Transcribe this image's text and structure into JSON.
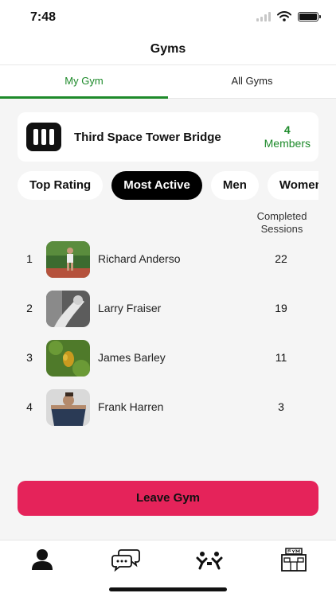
{
  "status_bar": {
    "time": "7:48"
  },
  "header": {
    "title": "Gyms"
  },
  "tabs": [
    {
      "label": "My Gym",
      "active": true
    },
    {
      "label": "All Gyms",
      "active": false
    }
  ],
  "gym": {
    "name": "Third Space Tower Bridge",
    "member_count": "4",
    "member_label": "Members"
  },
  "filters": [
    {
      "label": "Top Rating",
      "active": false
    },
    {
      "label": "Most Active",
      "active": true
    },
    {
      "label": "Men",
      "active": false
    },
    {
      "label": "Women",
      "active": false
    }
  ],
  "leaderboard": {
    "column_header": "Completed Sessions",
    "rows": [
      {
        "rank": "1",
        "name": "Richard Anderso",
        "sessions": "22"
      },
      {
        "rank": "2",
        "name": "Larry Fraiser",
        "sessions": "19"
      },
      {
        "rank": "3",
        "name": "James Barley",
        "sessions": "11"
      },
      {
        "rank": "4",
        "name": "Frank Harren",
        "sessions": "3"
      }
    ]
  },
  "actions": {
    "leave_label": "Leave Gym"
  },
  "colors": {
    "accent_green": "#1d8a2a",
    "leave_button": "#e5235a",
    "active_chip": "#000000"
  },
  "bottom_nav": [
    {
      "icon": "profile-icon",
      "active": true
    },
    {
      "icon": "chat-icon",
      "active": false
    },
    {
      "icon": "workout-icon",
      "active": false
    },
    {
      "icon": "gym-building-icon",
      "active": false
    }
  ]
}
